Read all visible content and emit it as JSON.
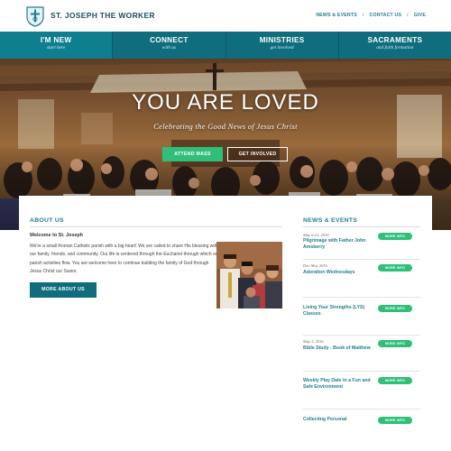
{
  "header": {
    "site_name": "ST. JOSEPH THE WORKER",
    "links": [
      "NEWS & EVENTS",
      "CONTACT US",
      "GIVE"
    ],
    "separator": "/"
  },
  "nav": [
    {
      "title": "I'M NEW",
      "subtitle": "start here"
    },
    {
      "title": "CONNECT",
      "subtitle": "with us"
    },
    {
      "title": "MINISTRIES",
      "subtitle": "get involved"
    },
    {
      "title": "SACRAMENTS",
      "subtitle": "and faith formation"
    }
  ],
  "hero": {
    "title": "YOU ARE LOVED",
    "subtitle": "Celebrating the Good News of Jesus Christ",
    "primary_button": "ATTEND MASS",
    "secondary_button": "GET INVOLVED"
  },
  "about": {
    "heading": "ABOUT US",
    "welcome": "Welcome to St. Joseph",
    "text": "We're a small Roman Catholic parish with a big heart! We are called to share His blessing with our family, friends, and community. Our life is centered through the Eucharist through which our parish activities flow. You are welcome here to continue building the family of God through Jesus Christ our Savior.",
    "button": "MORE ABOUT US"
  },
  "news": {
    "heading": "NEWS & EVENTS",
    "button_label": "MORE INFO",
    "items": [
      {
        "date": "May 6-21, 2016",
        "title": "Pilgrimage with Father John Amsberry"
      },
      {
        "date": "Dec-May 2016",
        "title": "Adoration Wednesdays"
      },
      {
        "date": "",
        "title": "Living Your Strengths (LYS) Classes"
      },
      {
        "date": "May 3, 2016",
        "title": "Bible Study - Book of Matthew"
      },
      {
        "date": "",
        "title": "Weekly Play Date in a Fun and Safe Environment"
      },
      {
        "date": "",
        "title": "Collecting Personal"
      }
    ]
  },
  "colors": {
    "teal": "#0f6d7d",
    "teal_text": "#1f7f92",
    "green": "#2fbf78",
    "brand_dark": "#1d4f5f"
  },
  "icons": {
    "logo": "parish-crest-icon"
  }
}
